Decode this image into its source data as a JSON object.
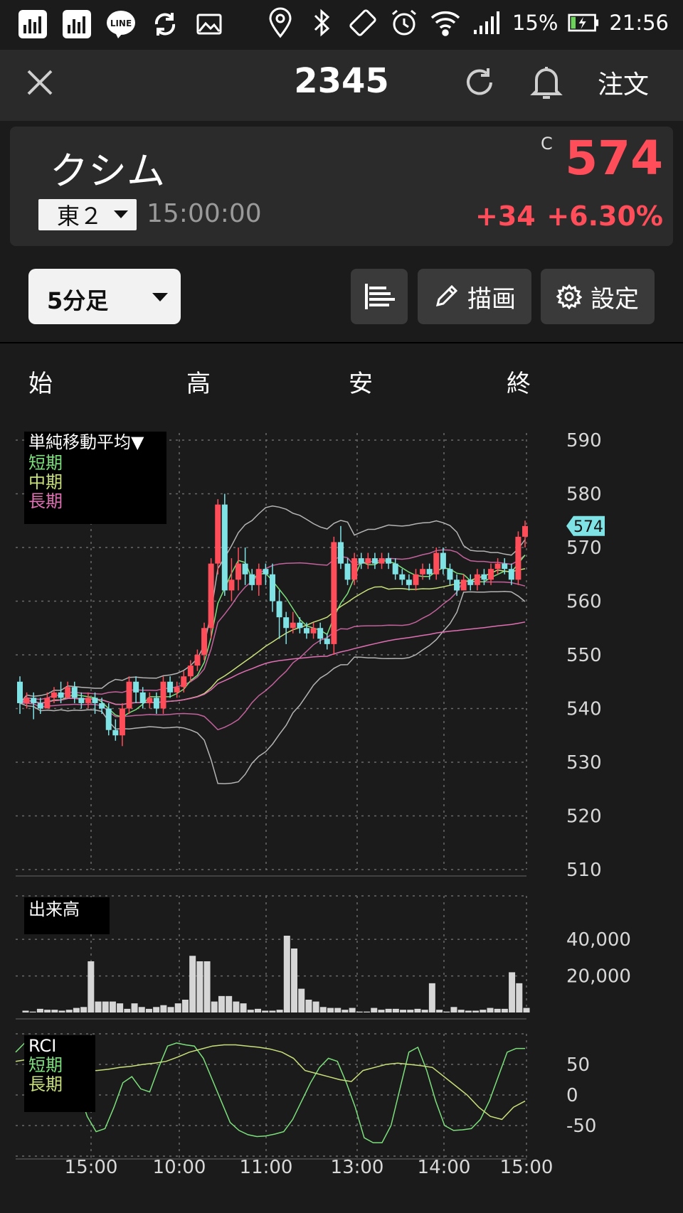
{
  "status_bar": {
    "battery": "15%",
    "time": "21:56",
    "left_icons": [
      "signal-chart-icon",
      "signal-chart-icon",
      "line-app-icon",
      "sync-icon",
      "image-icon"
    ],
    "right_icons": [
      "location-icon",
      "bluetooth-icon",
      "rotate-icon",
      "alarm-icon",
      "wifi-icon",
      "cell-signal-icon",
      "battery-charging-icon"
    ]
  },
  "header": {
    "title": "2345",
    "order_label": "注文"
  },
  "quote": {
    "name": "クシム",
    "market": "東２",
    "time": "15:00:00",
    "price_flag": "C",
    "price": "574",
    "change": "+34",
    "change_pct": "+6.30%"
  },
  "toolbar": {
    "interval": "5分足",
    "draw_label": "描画",
    "settings_label": "設定"
  },
  "ohlc_labels": {
    "open": "始",
    "high": "高",
    "low": "安",
    "close": "終"
  },
  "colors": {
    "up": "#ff4d5a",
    "down": "#7fe3e6",
    "grid": "#6a6a6a",
    "short": "#7be07b",
    "mid": "#c8e07b",
    "long": "#e06fb3",
    "band": "#cfcfcf"
  },
  "chart_data": [
    {
      "type": "candlestick",
      "legend": {
        "title": "単純移動平均▼",
        "short": "短期",
        "mid": "中期",
        "long": "長期"
      },
      "yticks": [
        510,
        520,
        530,
        540,
        550,
        560,
        570,
        580,
        590
      ],
      "ylim": [
        510,
        590
      ],
      "xticks": [
        "15:00",
        "10:00",
        "11:00",
        "13:00",
        "14:00",
        "15:00"
      ],
      "last_price_label": "574",
      "candles": [
        [
          545,
          541,
          546,
          539
        ],
        [
          541,
          542,
          543,
          540
        ],
        [
          542,
          541,
          543,
          538
        ],
        [
          541,
          540,
          542,
          539
        ],
        [
          540,
          542,
          543,
          540
        ],
        [
          542,
          543,
          544,
          541
        ],
        [
          543,
          542,
          545,
          541
        ],
        [
          542,
          544,
          545,
          542
        ],
        [
          544,
          542,
          545,
          541
        ],
        [
          542,
          541,
          543,
          540
        ],
        [
          541,
          542,
          543,
          540
        ],
        [
          542,
          541,
          543,
          539
        ],
        [
          541,
          540,
          542,
          539
        ],
        [
          540,
          536,
          541,
          535
        ],
        [
          536,
          535,
          538,
          534
        ],
        [
          535,
          540,
          541,
          533
        ],
        [
          540,
          545,
          546,
          539
        ],
        [
          545,
          543,
          546,
          541
        ],
        [
          543,
          541,
          544,
          540
        ],
        [
          541,
          542,
          543,
          540
        ],
        [
          542,
          540,
          543,
          539
        ],
        [
          540,
          545,
          546,
          539
        ],
        [
          545,
          543,
          546,
          542
        ],
        [
          543,
          544,
          545,
          542
        ],
        [
          544,
          546,
          547,
          543
        ],
        [
          546,
          548,
          549,
          545
        ],
        [
          548,
          550,
          551,
          547
        ],
        [
          550,
          555,
          556,
          549
        ],
        [
          555,
          567,
          568,
          553
        ],
        [
          567,
          578,
          579,
          565
        ],
        [
          578,
          562,
          580,
          561
        ],
        [
          562,
          564,
          568,
          560
        ],
        [
          564,
          567,
          570,
          562
        ],
        [
          567,
          565,
          570,
          563
        ],
        [
          565,
          563,
          566,
          562
        ],
        [
          563,
          566,
          567,
          561
        ],
        [
          566,
          565,
          567,
          563
        ],
        [
          565,
          560,
          567,
          558
        ],
        [
          560,
          557,
          562,
          553
        ],
        [
          557,
          555,
          558,
          552
        ],
        [
          555,
          556,
          558,
          554
        ],
        [
          556,
          555,
          557,
          554
        ],
        [
          555,
          554,
          556,
          553
        ],
        [
          554,
          555,
          556,
          553
        ],
        [
          555,
          553,
          556,
          552
        ],
        [
          553,
          552,
          554,
          551
        ],
        [
          552,
          571,
          572,
          550
        ],
        [
          571,
          567,
          574,
          566
        ],
        [
          567,
          564,
          568,
          563
        ],
        [
          564,
          568,
          569,
          563
        ],
        [
          568,
          567,
          569,
          566
        ],
        [
          567,
          568,
          569,
          566
        ],
        [
          568,
          567,
          569,
          566
        ],
        [
          567,
          568,
          569,
          566
        ],
        [
          568,
          567,
          569,
          566
        ],
        [
          567,
          565,
          568,
          564
        ],
        [
          565,
          564,
          566,
          563
        ],
        [
          564,
          563,
          565,
          562
        ],
        [
          563,
          565,
          566,
          562
        ],
        [
          565,
          566,
          567,
          564
        ],
        [
          566,
          565,
          567,
          564
        ],
        [
          565,
          569,
          570,
          564
        ],
        [
          569,
          566,
          570,
          565
        ],
        [
          566,
          564,
          567,
          563
        ],
        [
          564,
          562,
          565,
          561
        ],
        [
          562,
          564,
          565,
          562
        ],
        [
          564,
          563,
          565,
          562
        ],
        [
          563,
          565,
          566,
          562
        ],
        [
          565,
          564,
          566,
          563
        ],
        [
          564,
          566,
          567,
          563
        ],
        [
          566,
          567,
          568,
          565
        ],
        [
          567,
          566,
          568,
          565
        ],
        [
          566,
          564,
          567,
          563
        ],
        [
          564,
          572,
          573,
          563
        ],
        [
          572,
          574,
          575,
          570
        ]
      ]
    },
    {
      "type": "bar",
      "title": "出来高",
      "yticks": [
        "40,000",
        "20,000"
      ],
      "values": [
        1000,
        500,
        2000,
        1500,
        1500,
        1000,
        1500,
        2500,
        3000,
        28000,
        6000,
        6000,
        6000,
        5000,
        2000,
        5000,
        3000,
        2000,
        3000,
        4000,
        3000,
        5000,
        7000,
        31000,
        28000,
        28000,
        6000,
        9000,
        9000,
        6000,
        5000,
        1500,
        2000,
        1000,
        1000,
        1500,
        42000,
        35000,
        13000,
        7000,
        6000,
        3000,
        2500,
        2500,
        1500,
        2500,
        500,
        500,
        2500,
        1500,
        2000,
        2000,
        1500,
        1500,
        2000,
        1500,
        16000,
        1500,
        500,
        3000,
        1500,
        1000,
        1000,
        1500,
        2500,
        2000,
        2000,
        22000,
        16000,
        2500
      ]
    },
    {
      "type": "line",
      "title": "RCI",
      "legend": {
        "short": "短期",
        "long": "長期"
      },
      "yticks": [
        "50",
        "0",
        "-50"
      ],
      "ylim": [
        -100,
        100
      ],
      "series": [
        {
          "name": "短期",
          "values": [
            70,
            85,
            88,
            84,
            70,
            40,
            30,
            10,
            -35,
            -60,
            -55,
            -20,
            20,
            30,
            10,
            5,
            45,
            80,
            85,
            82,
            80,
            60,
            25,
            -10,
            -45,
            -58,
            -65,
            -68,
            -67,
            -64,
            -60,
            -40,
            -10,
            20,
            45,
            60,
            55,
            20,
            -20,
            -70,
            -78,
            -78,
            -50,
            10,
            70,
            78,
            40,
            -10,
            -50,
            -58,
            -57,
            -55,
            -40,
            -10,
            30,
            70,
            76,
            76
          ]
        },
        {
          "name": "長期",
          "values": [
            55,
            58,
            50,
            40,
            30,
            38,
            40,
            40,
            42,
            45,
            47,
            50,
            52,
            55,
            62,
            70,
            75,
            80,
            82,
            82,
            80,
            78,
            75,
            70,
            60,
            40,
            35,
            30,
            25,
            22,
            40,
            45,
            50,
            52,
            50,
            48,
            45,
            30,
            15,
            0,
            -20,
            -35,
            -40,
            -20,
            -10
          ]
        }
      ]
    }
  ]
}
